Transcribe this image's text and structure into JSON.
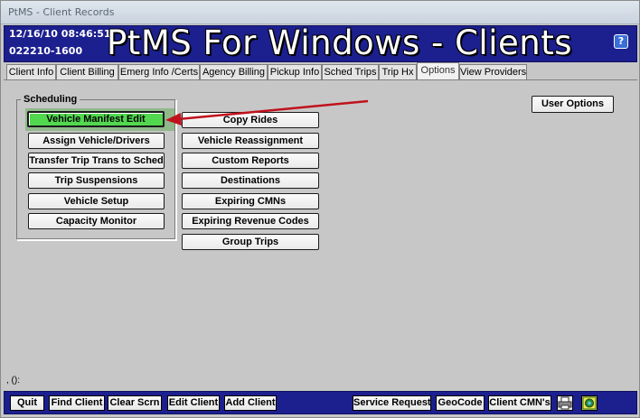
{
  "window": {
    "title": "PtMS - Client Records"
  },
  "header": {
    "date_time": "12/16/10  08:46:51",
    "client_id": "022210-1600",
    "title": "PtMS For Windows - Clients",
    "help": "?"
  },
  "tabs": [
    {
      "label": "Client Info"
    },
    {
      "label": "Client Billing"
    },
    {
      "label": "Emerg Info /Certs"
    },
    {
      "label": "Agency Billing"
    },
    {
      "label": "Pickup Info"
    },
    {
      "label": "Sched Trips"
    },
    {
      "label": "Trip Hx"
    },
    {
      "label": "Options"
    },
    {
      "label": "View Providers"
    }
  ],
  "active_tab": "Options",
  "scheduling": {
    "legend": "Scheduling",
    "buttons": [
      {
        "label": "Vehicle Manifest Edit"
      },
      {
        "label": "Assign Vehicle/Drivers"
      },
      {
        "label": "Transfer Trip Trans to Sched"
      },
      {
        "label": "Trip Suspensions"
      },
      {
        "label": "Vehicle Setup"
      },
      {
        "label": "Capacity Monitor"
      }
    ]
  },
  "options": {
    "buttons": [
      {
        "label": "Copy Rides"
      },
      {
        "label": "Vehicle Reassignment"
      },
      {
        "label": "Custom Reports"
      },
      {
        "label": "Destinations"
      },
      {
        "label": "Expiring CMNs"
      },
      {
        "label": "Expiring Revenue Codes"
      },
      {
        "label": "Group Trips"
      }
    ],
    "user_options": "User Options"
  },
  "status_text": ", ():",
  "bottom_bar": {
    "quit": "Quit",
    "find_client": "Find Client",
    "clear_scrn": "Clear Scrn",
    "edit_client": "Edit Client",
    "add_client": "Add Client",
    "service_request": "Service Request",
    "geocode": "GeoCode",
    "client_cmns": "Client CMN's",
    "icons": [
      "printer-icon",
      "map-globe-icon"
    ]
  },
  "colors": {
    "header_bg": "#1c1f8e",
    "highlight_green": "#52d84f",
    "arrow_red": "#c0121c"
  }
}
